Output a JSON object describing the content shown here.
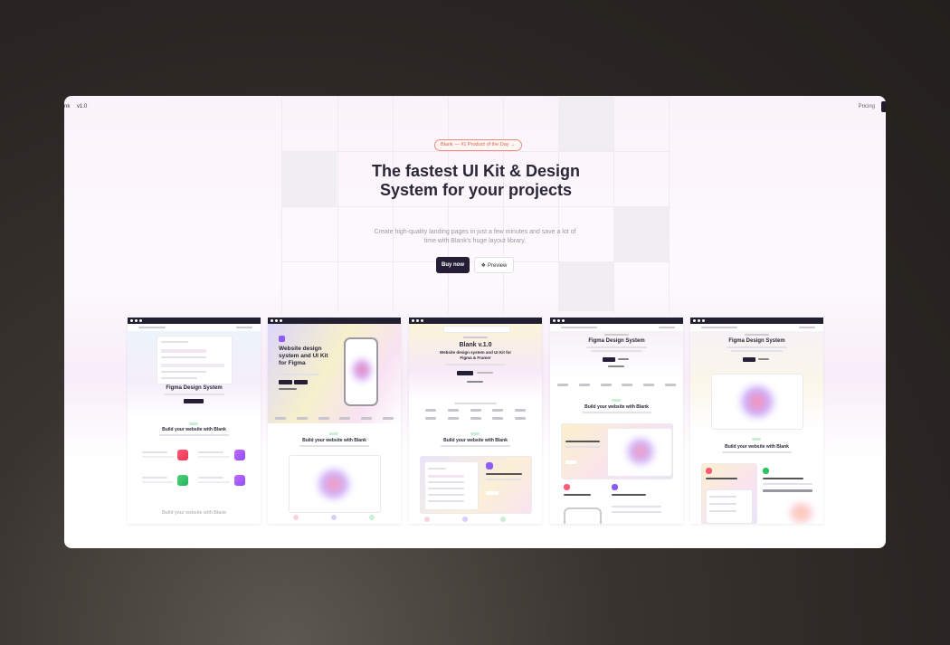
{
  "nav": {
    "brand": "nk",
    "version": "v1.0",
    "pricing": "Pricing"
  },
  "hero": {
    "badge": "Blank — #1 Product of the Day →",
    "headline": "The fastest UI Kit & Design System for your projects",
    "subtitle": "Create high-quality landing pages in just a few minutes and save a lot of time with Blank's huge layout library.",
    "buy_label": "Buy now",
    "preview_label": "Preview",
    "preview_icon": "figma-icon"
  },
  "thumbnails": [
    {
      "hero_title": "Figma Design System",
      "section_title": "Build your website with Blank",
      "footer_title": "Build your website with Blank"
    },
    {
      "hero_title": "Website design system and UI Kit for Figma",
      "section_title": "Build your website with Blank"
    },
    {
      "hero_title": "Blank v.1.0",
      "hero_subtitle": "Website design system and UI Kit for Figma & Framer",
      "section_title": "Build your website with Blank"
    },
    {
      "hero_title": "Figma Design System",
      "section_title": "Build your website with Blank"
    },
    {
      "hero_title": "Figma Design System",
      "section_title": "Build your website with Blank"
    }
  ],
  "colors": {
    "dark": "#241f36",
    "badge_accent": "#e0604c",
    "background": "#2a2522"
  }
}
